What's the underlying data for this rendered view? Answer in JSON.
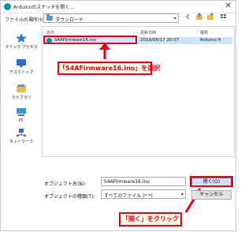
{
  "window": {
    "title": "Arduinoのスケッチを開く...",
    "close_glyph": "✕"
  },
  "location": {
    "label": "ファイルの場所(I):",
    "folder": "ダウンロード",
    "caret": "▾"
  },
  "toolbar": {
    "icons": [
      "back-icon",
      "up-folder-icon",
      "new-folder-icon",
      "view-menu-icon"
    ]
  },
  "sidebar": {
    "items": [
      {
        "label": "クイック アクセス",
        "icon": "star-icon"
      },
      {
        "label": "デスクトップ",
        "icon": "desktop-icon"
      },
      {
        "label": "ライブラリ",
        "icon": "library-icon"
      },
      {
        "label": "PC",
        "icon": "pc-icon"
      },
      {
        "label": "ネットワーク",
        "icon": "network-icon"
      }
    ]
  },
  "filelist": {
    "headers": {
      "name": "名前",
      "modified": "更新日時",
      "type": "種類"
    },
    "rows": [
      {
        "name": "S4AFirmware16.ino",
        "modified": "2019/06/17 20:07",
        "type": "Arduino ﬁ"
      }
    ]
  },
  "filename": {
    "label": "オブジェクト名(N):",
    "value": "S4AFirmware16.ino"
  },
  "filetype": {
    "label": "オブジェクトの種類(T):",
    "value": "すべてのファイル (*.*)",
    "caret": "▾"
  },
  "buttons": {
    "open": "開く(O)",
    "cancel": "キャンセル"
  },
  "annotations": {
    "select_file": "「S4AFirmware16.ino」を選択",
    "click_open": "「開く」をクリック",
    "color": "#e60012"
  }
}
